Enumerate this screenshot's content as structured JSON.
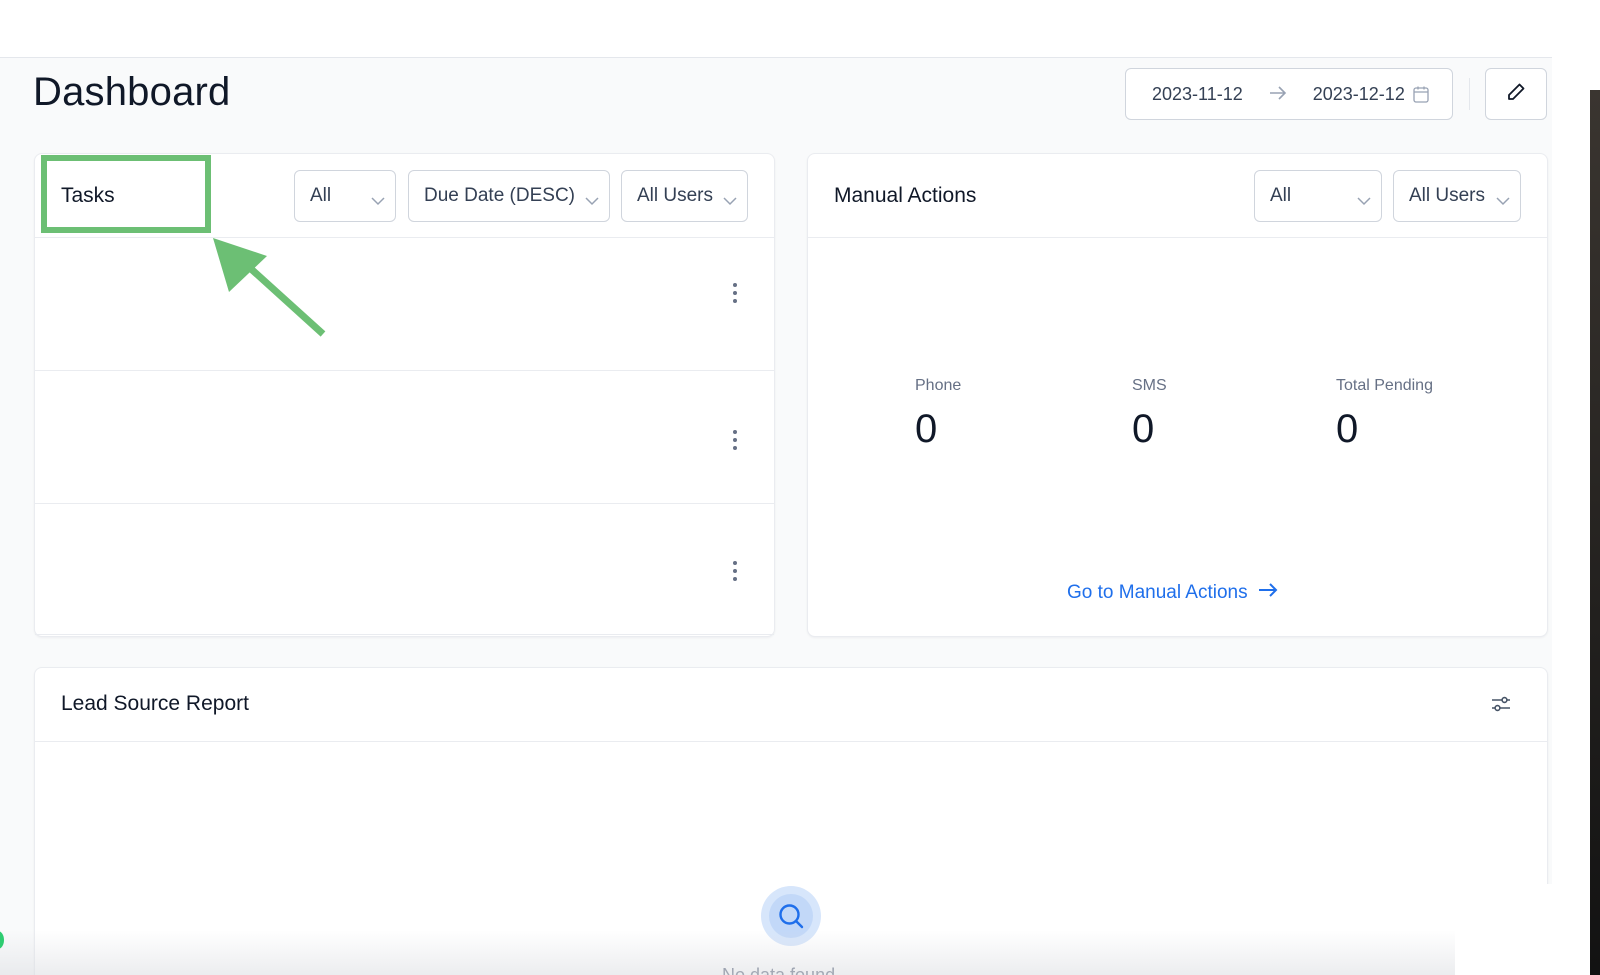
{
  "page": {
    "title": "Dashboard"
  },
  "date_range": {
    "start": "2023-11-12",
    "end": "2023-12-12"
  },
  "icons": {
    "date_arrow": "arrow-right-icon",
    "calendar": "calendar-icon",
    "edit": "pencil-icon",
    "chevron": "chevron-down-icon",
    "kebab": "more-vertical-icon",
    "filter": "sliders-icon",
    "search": "search-icon",
    "link_arrow": "arrow-right-icon"
  },
  "tasks": {
    "title": "Tasks",
    "filters": {
      "type": "All",
      "sort": "Due Date (DESC)",
      "users": "All Users"
    },
    "rows": [
      {},
      {},
      {}
    ]
  },
  "manual_actions": {
    "title": "Manual Actions",
    "filters": {
      "type": "All",
      "users": "All Users"
    },
    "stats": [
      {
        "label": "Phone",
        "value": "0"
      },
      {
        "label": "SMS",
        "value": "0"
      },
      {
        "label": "Total Pending",
        "value": "0"
      }
    ],
    "link": "Go to Manual Actions"
  },
  "lead_source_report": {
    "title": "Lead Source Report",
    "empty_text": "No data found"
  },
  "colors": {
    "highlight": "#6cbf74",
    "link": "#1f6feb",
    "background": "#f9fafb"
  }
}
